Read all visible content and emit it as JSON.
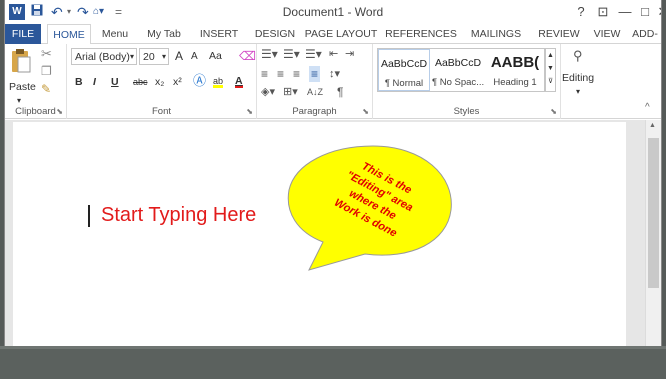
{
  "window": {
    "title": "Document1 - Word",
    "help": "?",
    "ribbon_display": "⊡",
    "minimize": "—",
    "restore": "□",
    "close": "✕"
  },
  "qat": {
    "word_icon": "W",
    "save_icon": "save-icon",
    "undo": "↶",
    "redo": "↷",
    "customize": "="
  },
  "tabs": [
    "FILE",
    "HOME",
    "Menu",
    "My Tab",
    "INSERT",
    "DESIGN",
    "PAGE LAYOUT",
    "REFERENCES",
    "MAILINGS",
    "REVIEW",
    "VIEW",
    "ADD-INS"
  ],
  "clipboard": {
    "paste_label": "Paste",
    "group_label": "Clipboard"
  },
  "font": {
    "family": "Arial (Body)",
    "size": "20",
    "grow": "A",
    "shrink": "A",
    "case": "Aa",
    "bold": "B",
    "italic": "I",
    "underline": "U",
    "strike": "abc",
    "sub": "x₂",
    "sup": "x²",
    "group_label": "Font"
  },
  "paragraph": {
    "group_label": "Paragraph",
    "sort": "A↓Z",
    "pilcrow": "¶"
  },
  "styles": {
    "items": [
      {
        "sample": "AaBbCcD",
        "name": "¶ Normal"
      },
      {
        "sample": "AaBbCcD",
        "name": "¶ No Spac..."
      },
      {
        "sample": "AABB(",
        "name": "Heading 1"
      }
    ],
    "group_label": "Styles"
  },
  "editing": {
    "label": "Editing"
  },
  "document": {
    "text": "Start Typing Here"
  },
  "callout": {
    "lines": [
      "This is the",
      "\"Editing\" area",
      "where the",
      "Work is done"
    ]
  },
  "colors": {
    "accent": "#2b579a",
    "callout_fill": "#ffff00",
    "callout_text": "#e00000",
    "doc_text": "#e21b1b"
  }
}
